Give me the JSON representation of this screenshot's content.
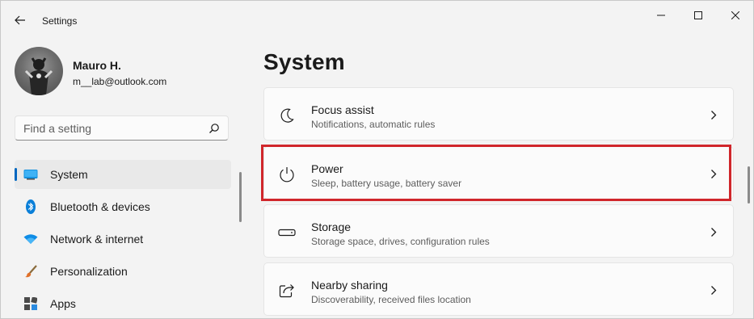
{
  "app": {
    "title": "Settings"
  },
  "profile": {
    "name": "Mauro H.",
    "email": "m__lab@outlook.com"
  },
  "search": {
    "placeholder": "Find a setting",
    "icon": "search-icon"
  },
  "sidebar": {
    "items": [
      {
        "label": "System",
        "icon": "monitor-icon",
        "selected": true
      },
      {
        "label": "Bluetooth & devices",
        "icon": "bluetooth-icon"
      },
      {
        "label": "Network & internet",
        "icon": "wifi-icon"
      },
      {
        "label": "Personalization",
        "icon": "brush-icon"
      },
      {
        "label": "Apps",
        "icon": "apps-icon"
      }
    ]
  },
  "main": {
    "title": "System",
    "cards": [
      {
        "title": "Focus assist",
        "description": "Notifications, automatic rules",
        "icon": "moon-icon"
      },
      {
        "title": "Power",
        "description": "Sleep, battery usage, battery saver",
        "icon": "power-icon",
        "highlighted": true
      },
      {
        "title": "Storage",
        "description": "Storage space, drives, configuration rules",
        "icon": "storage-icon"
      },
      {
        "title": "Nearby sharing",
        "description": "Discoverability, received files location",
        "icon": "share-icon"
      }
    ]
  },
  "colors": {
    "accent": "#0067c0",
    "highlight": "#d0262b",
    "background": "#f3f3f3",
    "card": "#fbfbfb"
  }
}
